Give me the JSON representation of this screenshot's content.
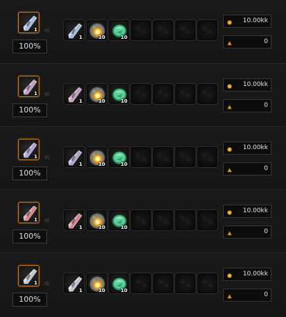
{
  "rows": [
    {
      "result": {
        "icon": "blue-crystal-icon",
        "qty": "1",
        "color": "#a9c3e6"
      },
      "chance": "100%",
      "materials": [
        {
          "icon": "blue-crystal-icon",
          "qty": "1"
        },
        {
          "icon": "fire-orb-icon",
          "qty": "10"
        },
        {
          "icon": "green-gem-icon",
          "qty": "10"
        }
      ],
      "gold": "10.00kk",
      "currency": "0"
    },
    {
      "result": {
        "icon": "pink-crystal-icon",
        "qty": "1",
        "color": "#c9a0c7"
      },
      "chance": "100%",
      "materials": [
        {
          "icon": "pink-crystal-icon",
          "qty": "1"
        },
        {
          "icon": "fire-orb-icon",
          "qty": "10"
        },
        {
          "icon": "green-gem-icon",
          "qty": "10"
        }
      ],
      "gold": "10.00kk",
      "currency": "0"
    },
    {
      "result": {
        "icon": "lilac-crystal-icon",
        "qty": "1",
        "color": "#b7a8d9"
      },
      "chance": "100%",
      "materials": [
        {
          "icon": "lilac-crystal-icon",
          "qty": "1"
        },
        {
          "icon": "fire-orb-icon",
          "qty": "10"
        },
        {
          "icon": "green-gem-icon",
          "qty": "10"
        }
      ],
      "gold": "10.00kk",
      "currency": "0"
    },
    {
      "result": {
        "icon": "red-crystal-icon",
        "qty": "1",
        "color": "#e08a8a"
      },
      "chance": "100%",
      "materials": [
        {
          "icon": "red-crystal-icon",
          "qty": "1"
        },
        {
          "icon": "fire-orb-icon",
          "qty": "10"
        },
        {
          "icon": "green-gem-icon",
          "qty": "10"
        }
      ],
      "gold": "10.00kk",
      "currency": "0"
    },
    {
      "result": {
        "icon": "silver-crystal-icon",
        "qty": "1",
        "color": "#c8ced8"
      },
      "chance": "100%",
      "materials": [
        {
          "icon": "silver-crystal-icon",
          "qty": "1"
        },
        {
          "icon": "fire-orb-icon",
          "qty": "10"
        },
        {
          "icon": "green-gem-icon",
          "qty": "10"
        }
      ],
      "gold": "10.00kk",
      "currency": "0"
    }
  ],
  "empty_slot_icon": "empty-slot-icon",
  "gold_icon": "gold-coin-icon",
  "currency_icon": "currency-icon",
  "arrow_icon": "double-chevron-left-icon",
  "accent_color": "#c47a2a"
}
